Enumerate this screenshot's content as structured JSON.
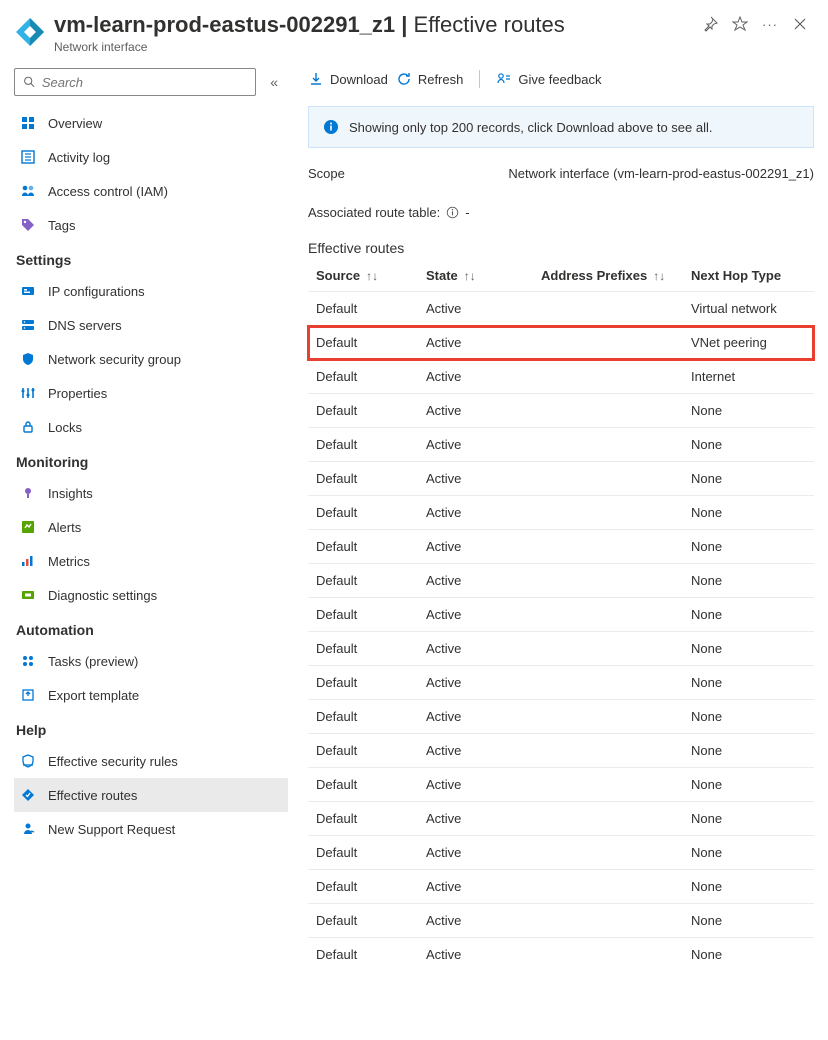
{
  "header": {
    "title": "vm-learn-prod-eastus-002291_z1",
    "separator": " | ",
    "subtitle_page": "Effective routes",
    "resource_type": "Network interface"
  },
  "search": {
    "placeholder": "Search"
  },
  "nav": {
    "top": [
      {
        "label": "Overview",
        "icon": "overview"
      },
      {
        "label": "Activity log",
        "icon": "activity-log"
      },
      {
        "label": "Access control (IAM)",
        "icon": "iam"
      },
      {
        "label": "Tags",
        "icon": "tags"
      }
    ],
    "groups": [
      {
        "title": "Settings",
        "items": [
          {
            "label": "IP configurations",
            "icon": "ip-config"
          },
          {
            "label": "DNS servers",
            "icon": "dns"
          },
          {
            "label": "Network security group",
            "icon": "nsg"
          },
          {
            "label": "Properties",
            "icon": "properties"
          },
          {
            "label": "Locks",
            "icon": "lock"
          }
        ]
      },
      {
        "title": "Monitoring",
        "items": [
          {
            "label": "Insights",
            "icon": "insights"
          },
          {
            "label": "Alerts",
            "icon": "alerts"
          },
          {
            "label": "Metrics",
            "icon": "metrics"
          },
          {
            "label": "Diagnostic settings",
            "icon": "diagnostics"
          }
        ]
      },
      {
        "title": "Automation",
        "items": [
          {
            "label": "Tasks (preview)",
            "icon": "tasks"
          },
          {
            "label": "Export template",
            "icon": "export"
          }
        ]
      },
      {
        "title": "Help",
        "items": [
          {
            "label": "Effective security rules",
            "icon": "eff-sec"
          },
          {
            "label": "Effective routes",
            "icon": "eff-routes",
            "selected": true
          },
          {
            "label": "New Support Request",
            "icon": "support"
          }
        ]
      }
    ]
  },
  "toolbar": {
    "download": "Download",
    "refresh": "Refresh",
    "feedback": "Give feedback"
  },
  "banner": "Showing only top 200 records, click Download above to see all.",
  "scope": {
    "label": "Scope",
    "value": "Network interface (vm-learn-prod-eastus-002291_z1)"
  },
  "assoc": {
    "label": "Associated route table:",
    "value": "-"
  },
  "table": {
    "title": "Effective routes",
    "columns": {
      "source": "Source",
      "state": "State",
      "prefixes": "Address Prefixes",
      "next_hop": "Next Hop Type"
    },
    "rows": [
      {
        "source": "Default",
        "state": "Active",
        "prefixes": "",
        "next_hop": "Virtual network",
        "highlight": false
      },
      {
        "source": "Default",
        "state": "Active",
        "prefixes": "",
        "next_hop": "VNet peering",
        "highlight": true
      },
      {
        "source": "Default",
        "state": "Active",
        "prefixes": "",
        "next_hop": "Internet",
        "highlight": false
      },
      {
        "source": "Default",
        "state": "Active",
        "prefixes": "",
        "next_hop": "None",
        "highlight": false
      },
      {
        "source": "Default",
        "state": "Active",
        "prefixes": "",
        "next_hop": "None",
        "highlight": false
      },
      {
        "source": "Default",
        "state": "Active",
        "prefixes": "",
        "next_hop": "None",
        "highlight": false
      },
      {
        "source": "Default",
        "state": "Active",
        "prefixes": "",
        "next_hop": "None",
        "highlight": false
      },
      {
        "source": "Default",
        "state": "Active",
        "prefixes": "",
        "next_hop": "None",
        "highlight": false
      },
      {
        "source": "Default",
        "state": "Active",
        "prefixes": "",
        "next_hop": "None",
        "highlight": false
      },
      {
        "source": "Default",
        "state": "Active",
        "prefixes": "",
        "next_hop": "None",
        "highlight": false
      },
      {
        "source": "Default",
        "state": "Active",
        "prefixes": "",
        "next_hop": "None",
        "highlight": false
      },
      {
        "source": "Default",
        "state": "Active",
        "prefixes": "",
        "next_hop": "None",
        "highlight": false
      },
      {
        "source": "Default",
        "state": "Active",
        "prefixes": "",
        "next_hop": "None",
        "highlight": false
      },
      {
        "source": "Default",
        "state": "Active",
        "prefixes": "",
        "next_hop": "None",
        "highlight": false
      },
      {
        "source": "Default",
        "state": "Active",
        "prefixes": "",
        "next_hop": "None",
        "highlight": false
      },
      {
        "source": "Default",
        "state": "Active",
        "prefixes": "",
        "next_hop": "None",
        "highlight": false
      },
      {
        "source": "Default",
        "state": "Active",
        "prefixes": "",
        "next_hop": "None",
        "highlight": false
      },
      {
        "source": "Default",
        "state": "Active",
        "prefixes": "",
        "next_hop": "None",
        "highlight": false
      },
      {
        "source": "Default",
        "state": "Active",
        "prefixes": "",
        "next_hop": "None",
        "highlight": false
      },
      {
        "source": "Default",
        "state": "Active",
        "prefixes": "",
        "next_hop": "None",
        "highlight": false
      }
    ]
  },
  "icon_colors": {
    "overview": "#0078d4",
    "activity-log": "#0078d4",
    "iam": "#0078d4",
    "tags": "#8661c5",
    "ip-config": "#0078d4",
    "dns": "#0078d4",
    "nsg": "#0078d4",
    "properties": "#0078d4",
    "lock": "#0078d4",
    "insights": "#8661c5",
    "alerts": "#57a300",
    "metrics": "#0078d4",
    "diagnostics": "#57a300",
    "tasks": "#0078d4",
    "export": "#0078d4",
    "eff-sec": "#0078d4",
    "eff-routes": "#0078d4",
    "support": "#0078d4"
  }
}
